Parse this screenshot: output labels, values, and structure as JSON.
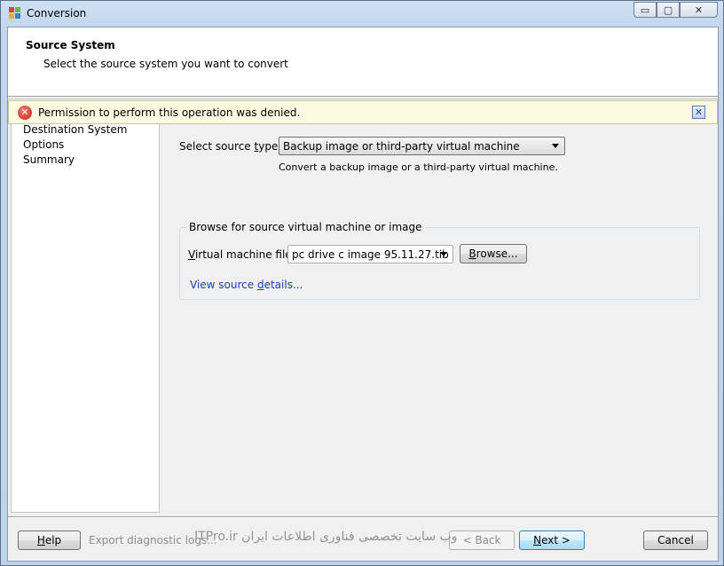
{
  "window": {
    "title": "Conversion",
    "minimize_glyph": "▭",
    "maximize_glyph": "▢",
    "close_glyph": "✕"
  },
  "header": {
    "title": "Source System",
    "subtitle": "Select the source system you want to convert"
  },
  "alert": {
    "message": "Permission to perform this operation was denied.",
    "icon": "error-icon",
    "icon_glyph": "✕",
    "close_glyph": "✕"
  },
  "nav": {
    "items": [
      {
        "label": "Destination System"
      },
      {
        "label": "Options"
      },
      {
        "label": "Summary"
      }
    ]
  },
  "source": {
    "type_label_pre": "Select source ",
    "type_label_accel": "t",
    "type_label_post": "ype:",
    "type_value": "Backup image or third-party virtual machine",
    "type_hint": "Convert a backup image or a third-party virtual machine.",
    "group_title": "Browse for source virtual machine or image",
    "file_label_accel": "V",
    "file_label_post": "irtual machine file:",
    "file_value": "pc drive c image 95.11.27.tib",
    "browse_accel": "B",
    "browse_post": "rowse...",
    "details_link_pre": "View source ",
    "details_link_accel": "d",
    "details_link_post": "etails..."
  },
  "footer": {
    "help_accel": "H",
    "help_post": "elp",
    "export_label": "Export diagnostic logs...",
    "back_label": "< Back",
    "next_accel": "N",
    "next_post": "ext >",
    "cancel_label": "Cancel",
    "watermark": "وب سایت تخصصی فناوری اطلاعات ایران ITPro.ir"
  },
  "colors": {
    "alert_bg": "#fcfbe2",
    "link": "#1a3fb8",
    "error": "#c6241b"
  }
}
